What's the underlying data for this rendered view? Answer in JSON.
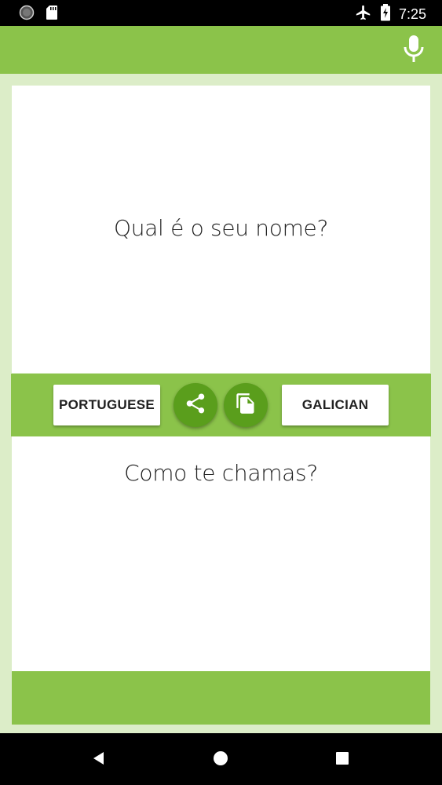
{
  "status_bar": {
    "time": "7:25",
    "icons": [
      "circle-notification-icon",
      "sd-card-icon",
      "airplane-mode-icon",
      "battery-charging-icon"
    ]
  },
  "app_bar": {
    "mic_icon": "microphone-icon"
  },
  "translation": {
    "source_text": "Qual é o seu nome?",
    "target_text": "Como te chamas?"
  },
  "controls": {
    "source_language": "PORTUGUESE",
    "target_language": "GALICIAN",
    "share_icon": "share-icon",
    "copy_icon": "copy-icon"
  },
  "colors": {
    "primary": "#8bc34a",
    "primary_dark": "#5a9e1c",
    "background": "#dcedc8"
  },
  "nav_bar": {
    "icons": [
      "back-icon",
      "home-icon",
      "recent-apps-icon"
    ]
  }
}
